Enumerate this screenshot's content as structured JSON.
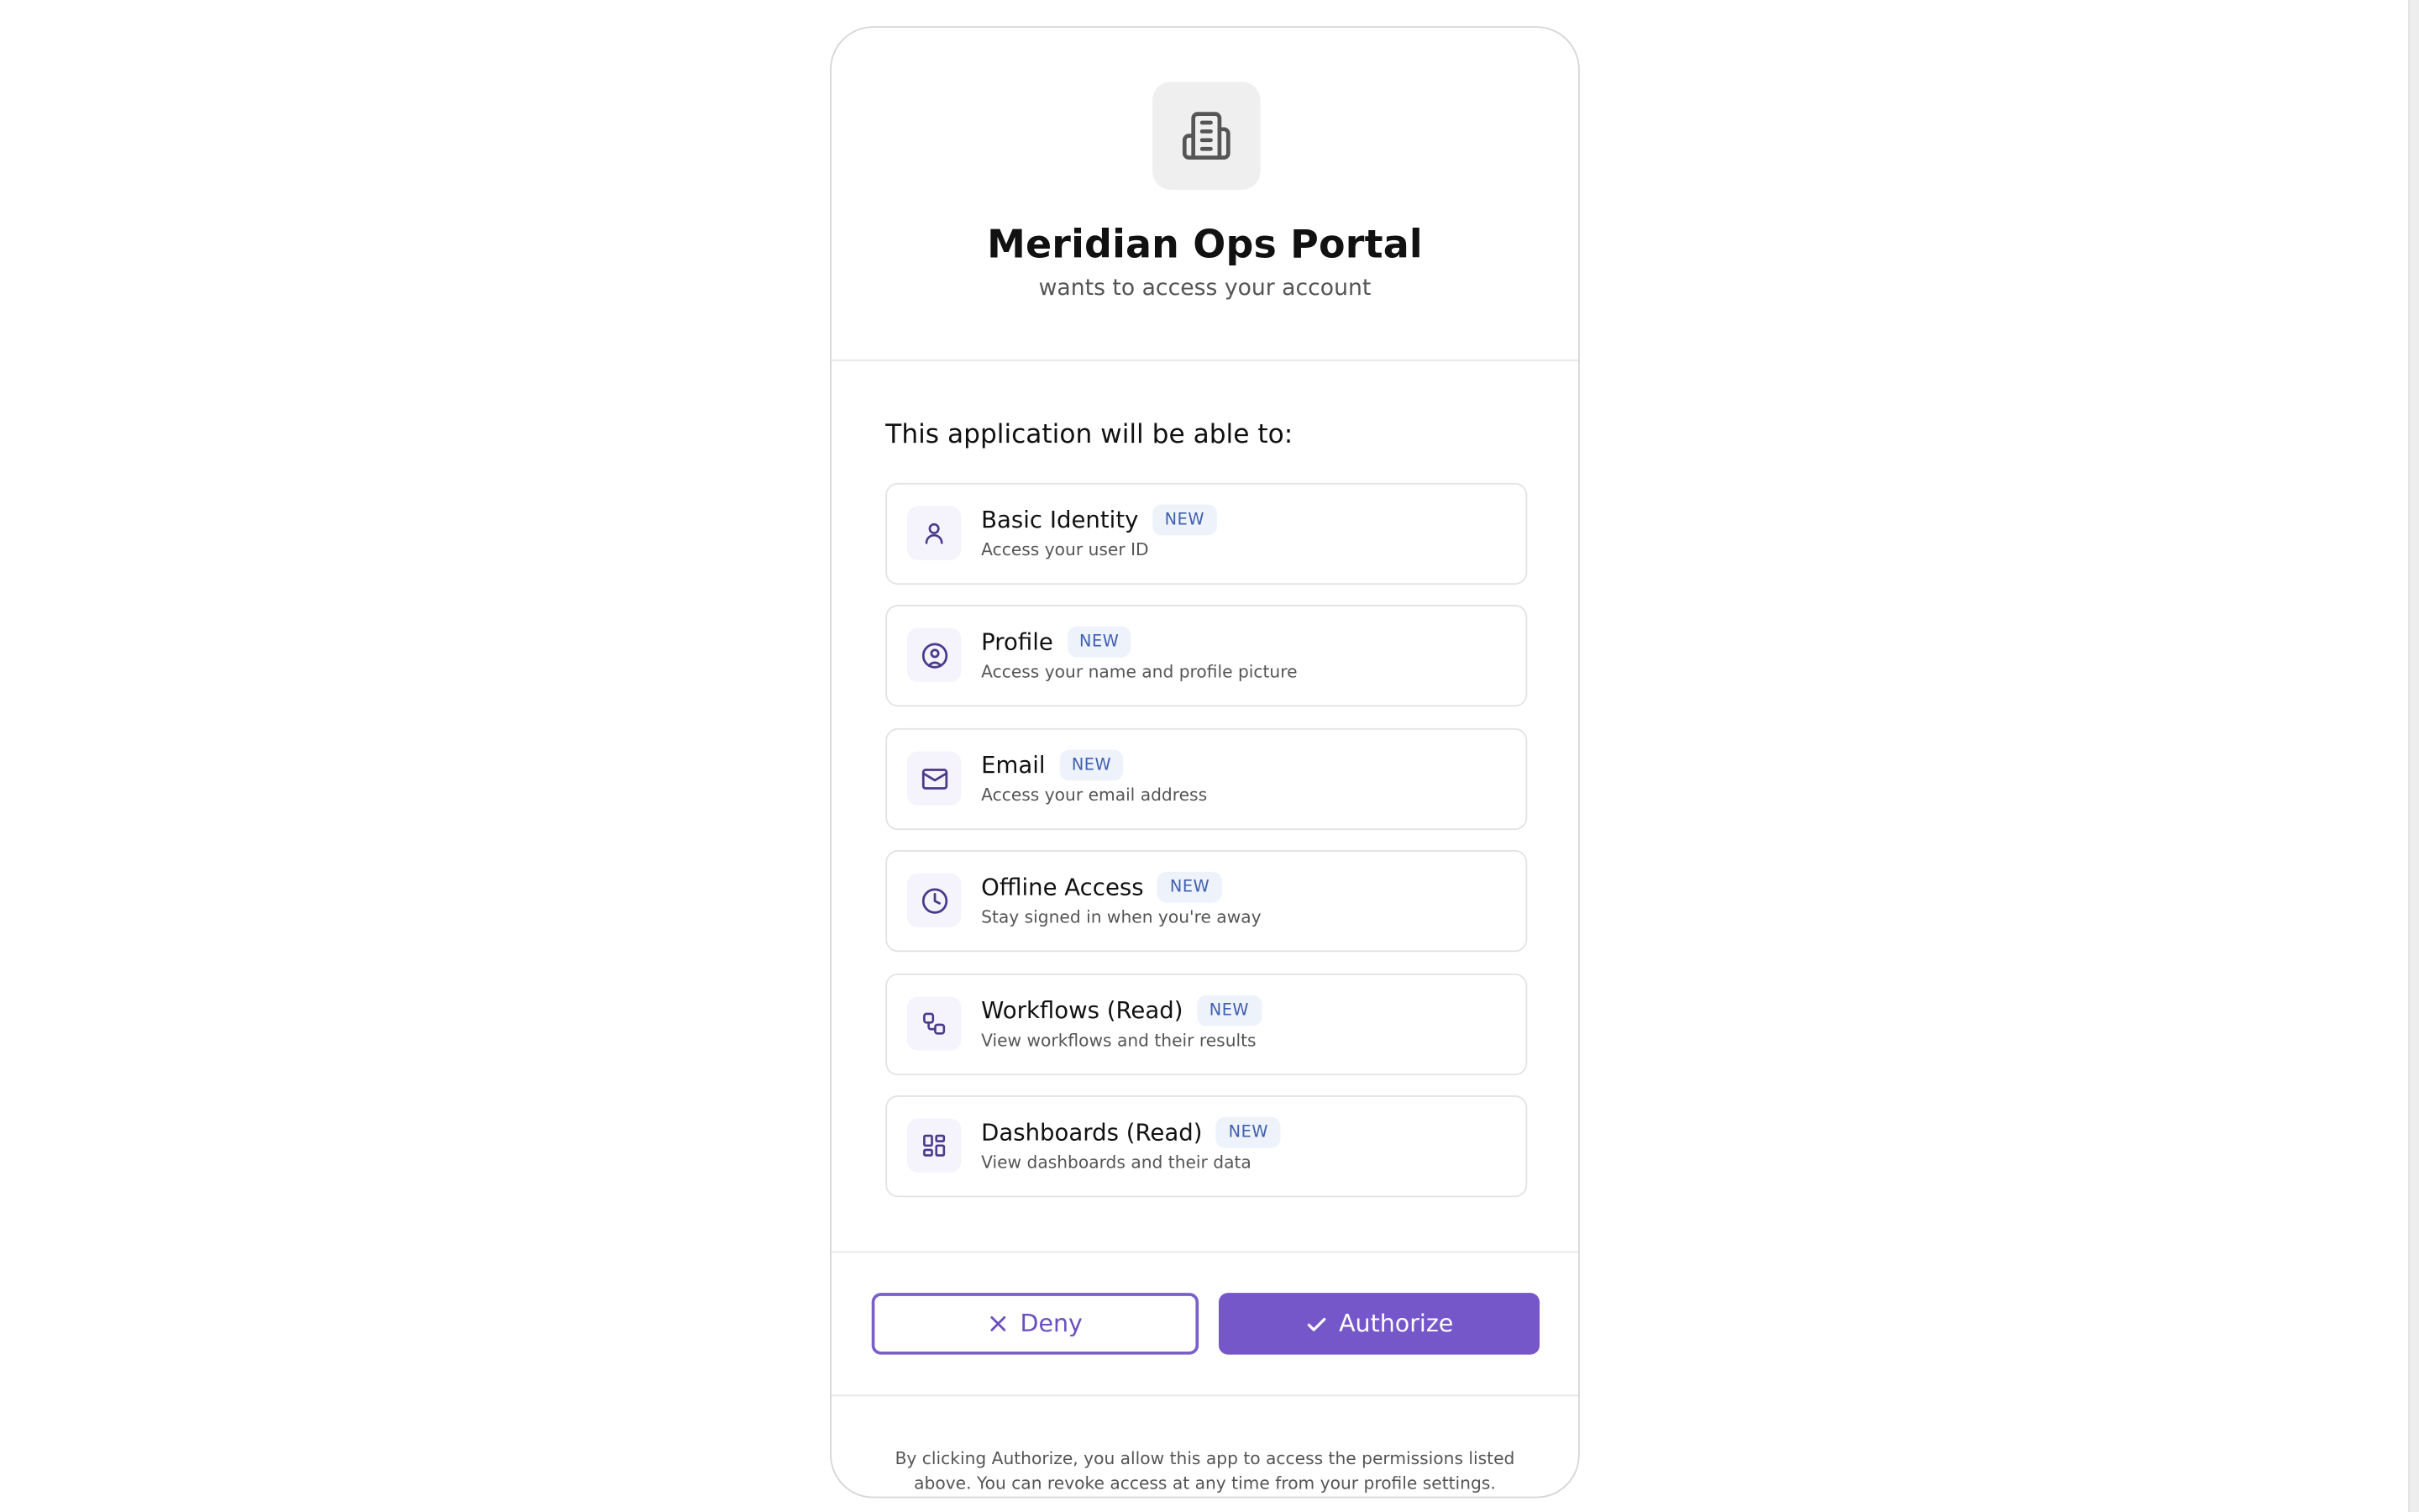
{
  "app": {
    "name": "Meridian Ops Portal",
    "subtitle": "wants to access your account",
    "logo_icon": "building-icon"
  },
  "permissions": {
    "heading": "This application will be able to:",
    "items": [
      {
        "title": "Basic Identity",
        "badge": "NEW",
        "description": "Access your user ID",
        "icon": "user-icon"
      },
      {
        "title": "Profile",
        "badge": "NEW",
        "description": "Access your name and profile picture",
        "icon": "user-circle-icon"
      },
      {
        "title": "Email",
        "badge": "NEW",
        "description": "Access your email address",
        "icon": "mail-icon"
      },
      {
        "title": "Offline Access",
        "badge": "NEW",
        "description": "Stay signed in when you're away",
        "icon": "clock-icon"
      },
      {
        "title": "Workflows (Read)",
        "badge": "NEW",
        "description": "View workflows and their results",
        "icon": "workflow-icon"
      },
      {
        "title": "Dashboards (Read)",
        "badge": "NEW",
        "description": "View dashboards and their data",
        "icon": "dashboard-icon"
      }
    ]
  },
  "actions": {
    "deny_label": "Deny",
    "authorize_label": "Authorize"
  },
  "footer": {
    "note": "By clicking Authorize, you allow this app to access the permissions listed above. You can revoke access at any time from your profile settings."
  },
  "colors": {
    "accent": "#7657c9",
    "badge_text": "#3f5fae",
    "badge_bg": "#eef2fb",
    "icon_bg": "#f5f3fb"
  }
}
